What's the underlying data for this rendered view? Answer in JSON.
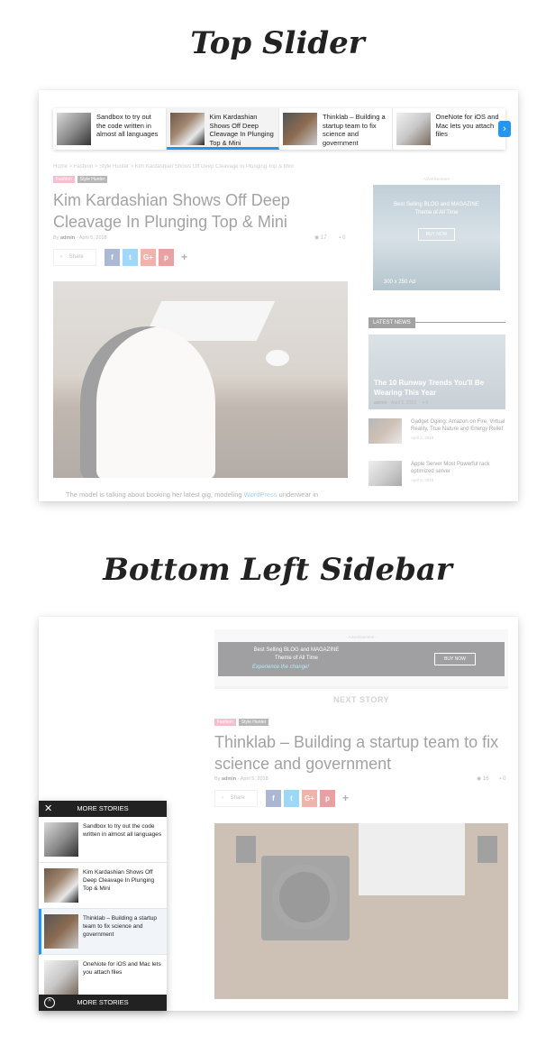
{
  "sections": {
    "top_title": "Top Slider",
    "bottom_title": "Bottom Left Sidebar"
  },
  "slider": {
    "items": [
      {
        "title": "Sandbox to try out the code written in almost all languages",
        "thumb_icon": "laptop-photo"
      },
      {
        "title": "Kim Kardashian Shows Off Deep Cleavage In Plunging Top & Mini",
        "thumb_icon": "chair-laptop-photo"
      },
      {
        "title": "Thinklab – Building a startup team to fix science and government",
        "thumb_icon": "turntable-photo"
      },
      {
        "title": "OneNote for iOS and Mac lets you attach files",
        "thumb_icon": "tablet-photo"
      }
    ],
    "next_icon": "chevron-right-icon",
    "accent": "#2196f3"
  },
  "post1": {
    "breadcrumb": "Home  >  Fashion  >  Style Hunter  >  Kim Kardashian Shows Off Deep Cleavage In Plunging Top & Mini",
    "categories": [
      "Fashion",
      "Style Hunter"
    ],
    "title": "Kim Kardashian Shows Off Deep Cleavage In Plunging Top & Mini",
    "author_prefix": "By",
    "author": "admin",
    "date": "April 5, 2018",
    "views": "17",
    "comments": "0",
    "share_label": "Share",
    "body_start": "The model is talking about booking her latest gig, modeling ",
    "body_link": "WordPress",
    "body_end": " underwear in"
  },
  "sidebar": {
    "ad_label": "- Advertisement -",
    "ad_line1": "Best Selling BLOG and MAGAZINE",
    "ad_line2": "Theme of All Time",
    "ad_button": "BUY NOW",
    "ad_size": "300 x 250 Ad",
    "latest_heading": "LATEST NEWS",
    "featured": {
      "title": "The 10 Runway Trends You'll Be Wearing This Year",
      "author": "admin",
      "date": "April 5, 2018",
      "comments": "0"
    },
    "items": [
      {
        "title": "Gadget Ogling: Amazon on Fire, Virtual Reality, True Nature and Energy Relief",
        "date": "April 5, 2018"
      },
      {
        "title": "Apple Server Most Powerful rack optimized server",
        "date": "April 5, 2018"
      }
    ]
  },
  "post2": {
    "ad_label": "- Advertisement -",
    "ad_line1": "Best Selling BLOG and MAGAZINE",
    "ad_line2": "Theme of All Time",
    "ad_tagline": "Experience the change!",
    "ad_button": "BUY NOW",
    "next_story": "NEXT STORY",
    "categories": [
      "Fashion",
      "Style Hunter"
    ],
    "title": "Thinklab – Building a startup team to fix science and government",
    "author_prefix": "By",
    "author": "admin",
    "date": "April 5, 2018",
    "views": "16",
    "comments": "0",
    "share_label": "Share"
  },
  "more_stories": {
    "heading": "MORE STORIES",
    "footer": "MORE STORIES",
    "items": [
      {
        "title": "Sandbox to try out the code written in almost all languages"
      },
      {
        "title": "Kim Kardashian Shows Off Deep Cleavage In Plunging Top & Mini"
      },
      {
        "title": "Thinklab – Building a startup team to fix science and government"
      },
      {
        "title": "OneNote for iOS and Mac lets you attach files"
      }
    ]
  },
  "share_buttons": {
    "facebook": "f",
    "twitter": "t",
    "google": "G+",
    "pinterest": "p",
    "more": "+"
  }
}
